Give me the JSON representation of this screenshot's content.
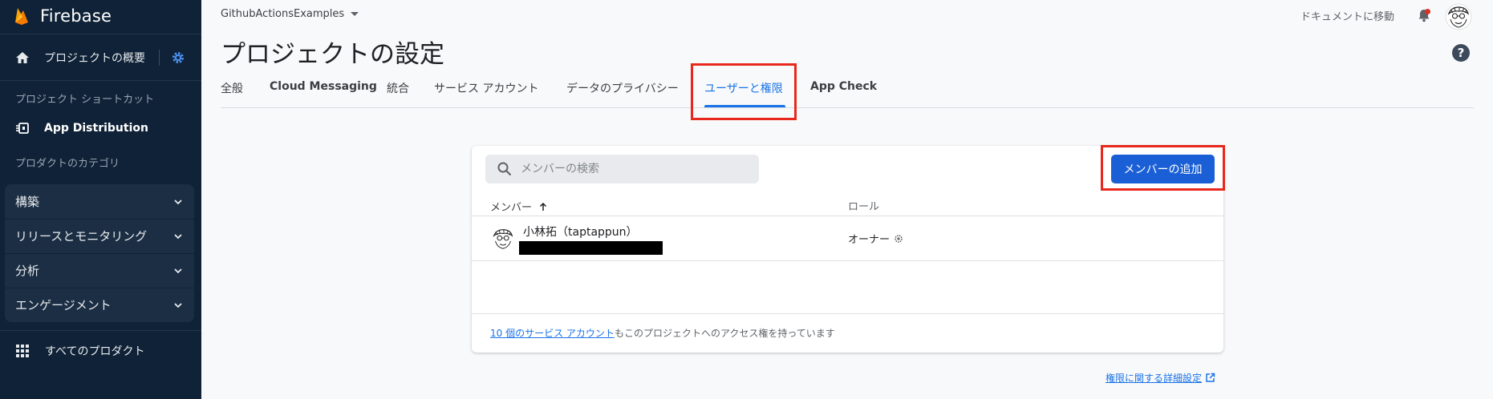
{
  "sidebar": {
    "brand": "Firebase",
    "overview_label": "プロジェクトの概要",
    "shortcuts_heading": "プロジェクト ショートカット",
    "app_distribution": "App Distribution",
    "categories_heading": "プロダクトのカテゴリ",
    "categories": [
      {
        "label": "構築"
      },
      {
        "label": "リリースとモニタリング"
      },
      {
        "label": "分析"
      },
      {
        "label": "エンゲージメント"
      }
    ],
    "all_products": "すべてのプロダクト"
  },
  "header": {
    "project_name": "GithubActionsExamples",
    "docs_link": "ドキュメントに移動",
    "page_title": "プロジェクトの設定",
    "help_glyph": "?"
  },
  "tabs": [
    {
      "label": "全般",
      "active": false
    },
    {
      "label": "Cloud Messaging",
      "active": false
    },
    {
      "label": "統合",
      "active": false
    },
    {
      "label": "サービス アカウント",
      "active": false
    },
    {
      "label": "データのプライバシー",
      "active": false
    },
    {
      "label": "ユーザーと権限",
      "active": true
    },
    {
      "label": "App Check",
      "active": false
    }
  ],
  "members": {
    "search_placeholder": "メンバーの検索",
    "add_button": "メンバーの追加",
    "col_member": "メンバー",
    "col_role": "ロール",
    "rows": [
      {
        "name": "小林拓（taptappun）",
        "role": "オーナー"
      }
    ],
    "footer_link": "10 個のサービス アカウント",
    "footer_text": "もこのプロジェクトへのアクセス権を持っています"
  },
  "permissions_link": "権限に関する詳細設定",
  "colors": {
    "sidebar_bg": "#0f2237",
    "accent": "#1a73e8",
    "highlight": "#e8281c",
    "button": "#1a5fd6"
  }
}
